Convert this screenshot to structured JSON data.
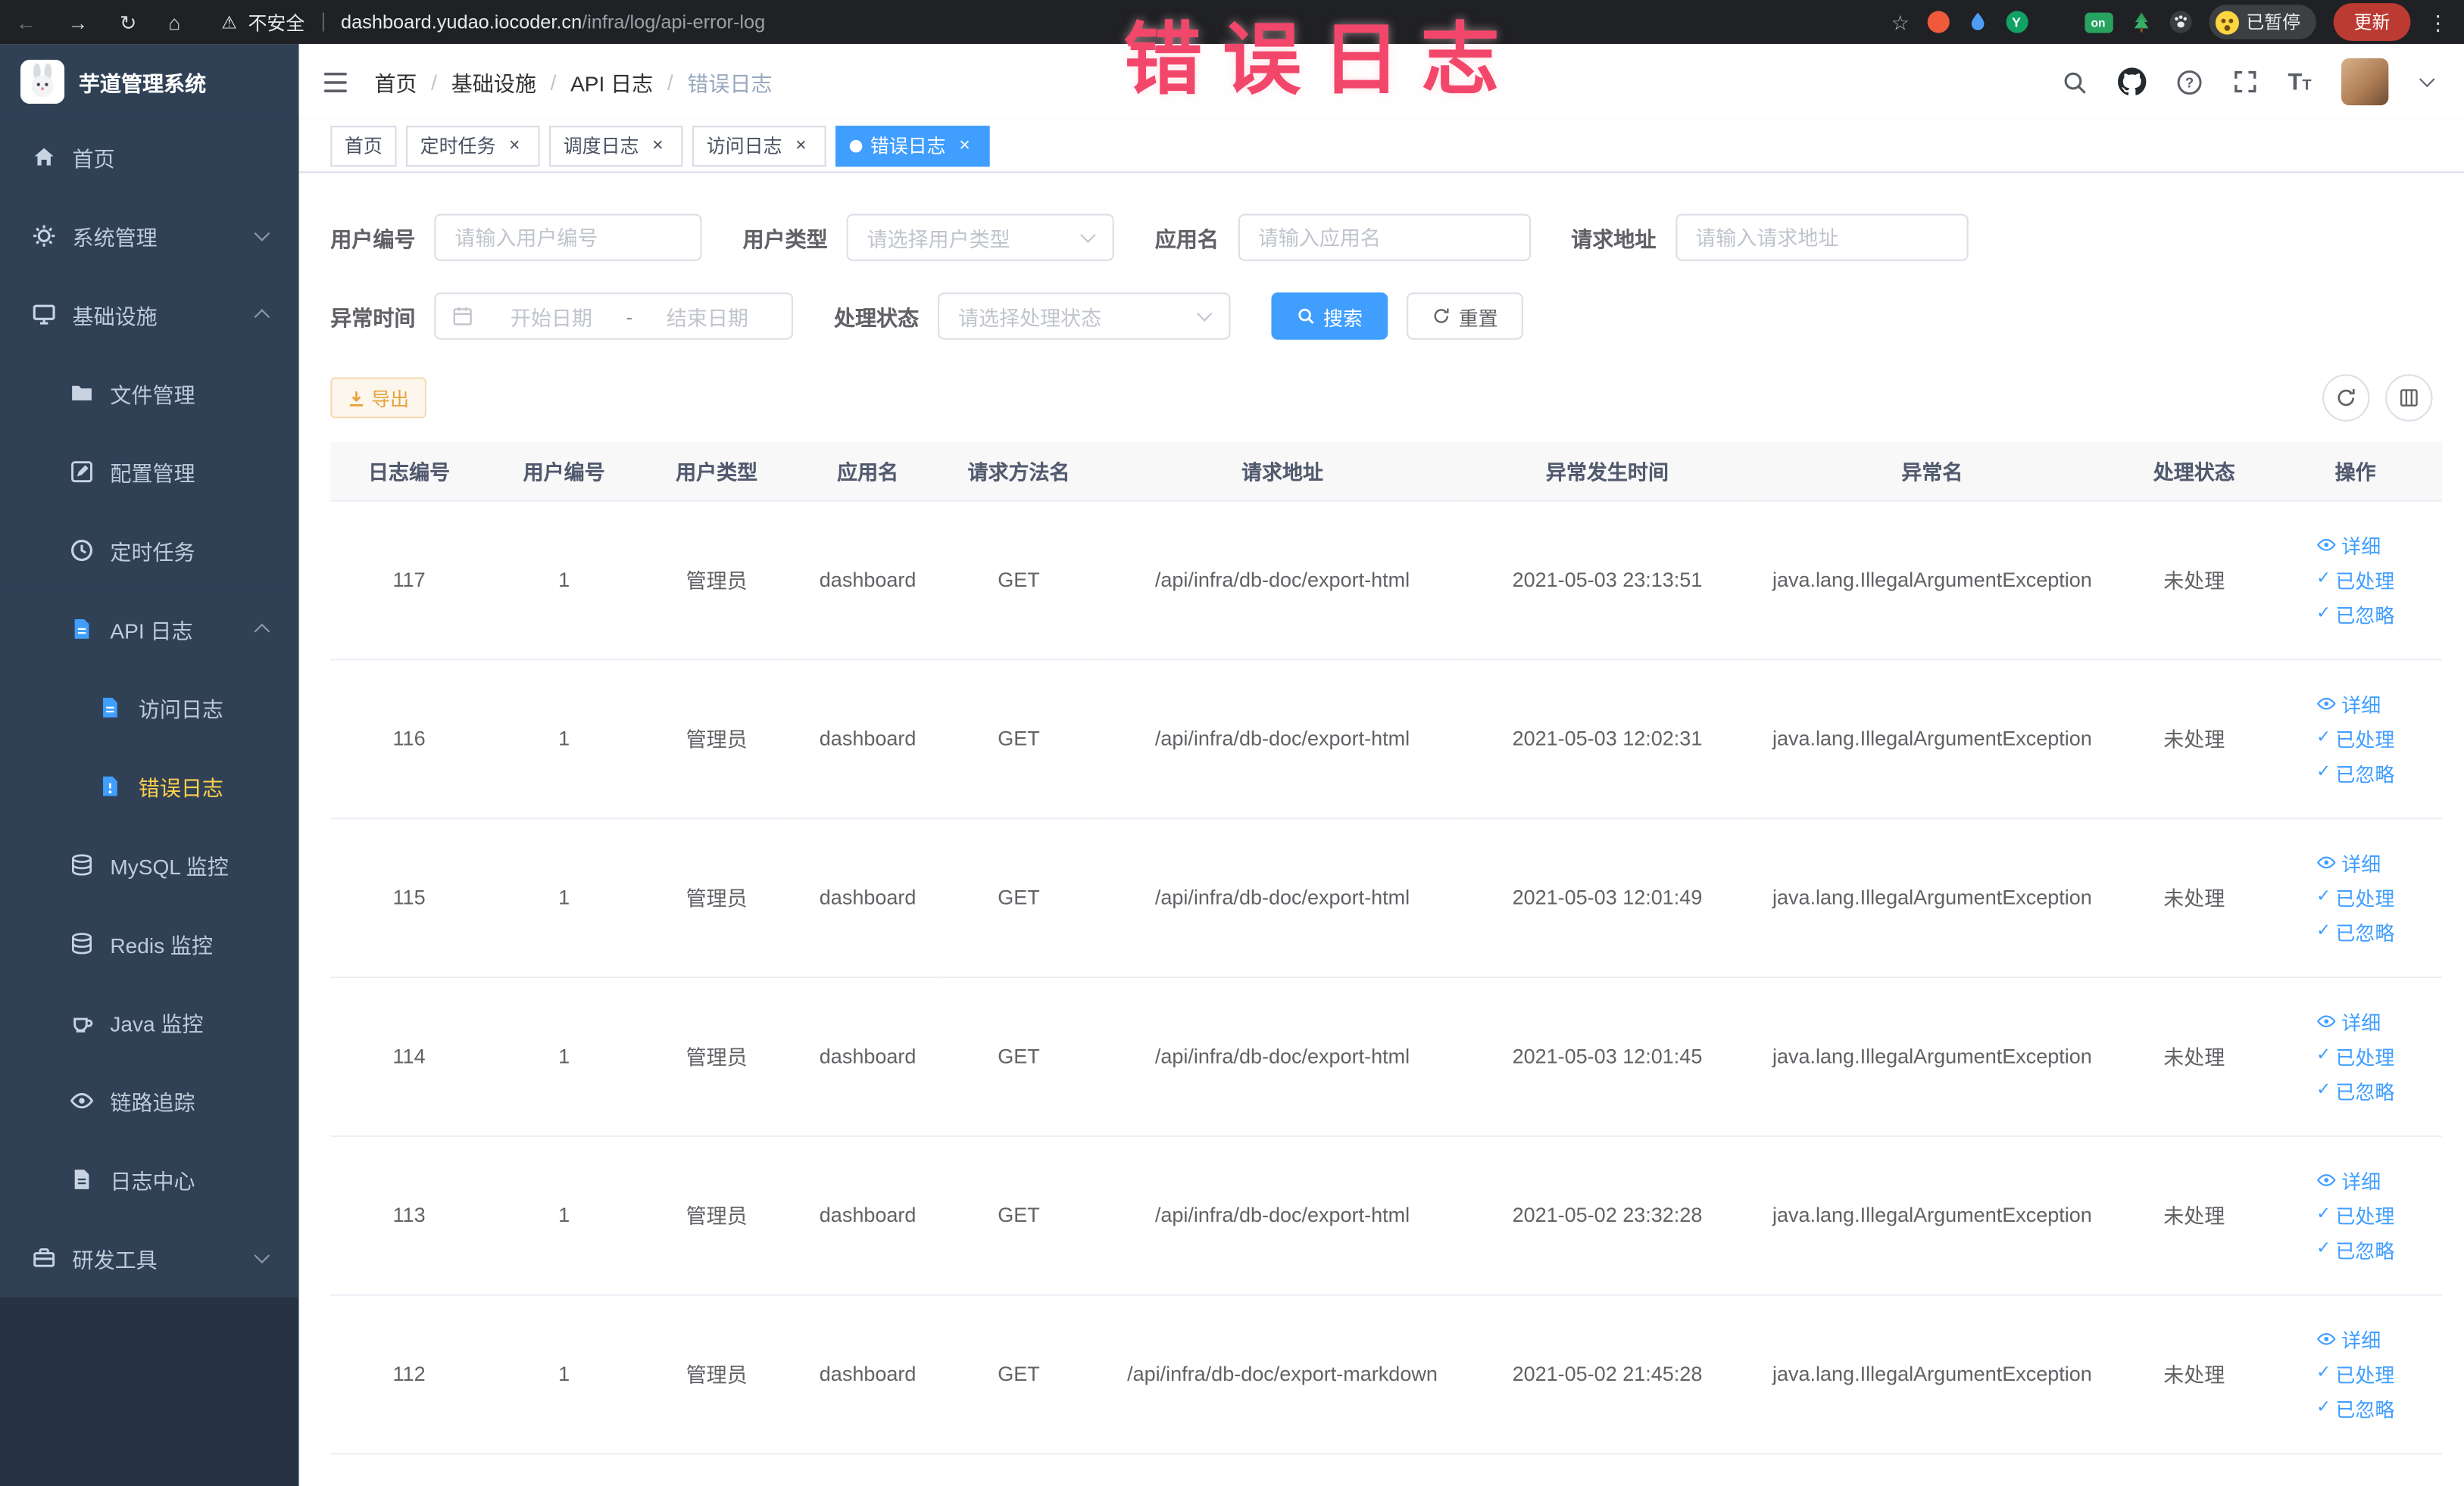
{
  "colors": {
    "primary": "#409eff",
    "warning": "#e6a23c",
    "sidebar_bg": "#304156",
    "sidebar_active_text": "#ffd04b",
    "annotation_red": "#f2476a"
  },
  "browser": {
    "security_label": "不安全",
    "url_domain": "dashboard.yudao.iocoder.cn",
    "url_path": "/infra/log/api-error-log",
    "on_badge": "on",
    "paused_badge": "已暂停",
    "update_button": "更新"
  },
  "annotation": "错误日志",
  "sidebar": {
    "logo_title": "芋道管理系统",
    "items": [
      {
        "key": "home",
        "label": "首页",
        "level": 1,
        "icon": "home"
      },
      {
        "key": "system-mgmt",
        "label": "系统管理",
        "level": 1,
        "icon": "system",
        "arrow": "down"
      },
      {
        "key": "infrastructure",
        "label": "基础设施",
        "level": 1,
        "icon": "infra",
        "arrow": "up"
      },
      {
        "key": "file-mgmt",
        "label": "文件管理",
        "level": 2,
        "icon": "file"
      },
      {
        "key": "config-mgmt",
        "label": "配置管理",
        "level": 2,
        "icon": "config"
      },
      {
        "key": "scheduled-jobs",
        "label": "定时任务",
        "level": 2,
        "icon": "job"
      },
      {
        "key": "api-log",
        "label": "API 日志",
        "level": 2,
        "icon": "api-log",
        "arrow": "up"
      },
      {
        "key": "access-log",
        "label": "访问日志",
        "level": 3,
        "icon": "access-log"
      },
      {
        "key": "error-log",
        "label": "错误日志",
        "level": 3,
        "icon": "error-log",
        "active": true
      },
      {
        "key": "mysql-monitor",
        "label": "MySQL 监控",
        "level": 2,
        "icon": "mysql"
      },
      {
        "key": "redis-monitor",
        "label": "Redis 监控",
        "level": 2,
        "icon": "redis"
      },
      {
        "key": "java-monitor",
        "label": "Java 监控",
        "level": 2,
        "icon": "java"
      },
      {
        "key": "link-trace",
        "label": "链路追踪",
        "level": 2,
        "icon": "trace"
      },
      {
        "key": "log-center",
        "label": "日志中心",
        "level": 2,
        "icon": "log-center"
      },
      {
        "key": "dev-tools",
        "label": "研发工具",
        "level": 1,
        "icon": "dev-tools",
        "arrow": "down"
      }
    ]
  },
  "header": {
    "breadcrumb": [
      "首页",
      "基础设施",
      "API 日志",
      "错误日志"
    ]
  },
  "tabs": [
    {
      "label": "首页",
      "closable": false,
      "active": false
    },
    {
      "label": "定时任务",
      "closable": true,
      "active": false
    },
    {
      "label": "调度日志",
      "closable": true,
      "active": false
    },
    {
      "label": "访问日志",
      "closable": true,
      "active": false
    },
    {
      "label": "错误日志",
      "closable": true,
      "active": true
    }
  ],
  "filters": {
    "user_id": {
      "label": "用户编号",
      "placeholder": "请输入用户编号",
      "value": ""
    },
    "user_type": {
      "label": "用户类型",
      "placeholder": "请选择用户类型",
      "value": ""
    },
    "app_name": {
      "label": "应用名",
      "placeholder": "请输入应用名",
      "value": ""
    },
    "request_url": {
      "label": "请求地址",
      "placeholder": "请输入请求地址",
      "value": ""
    },
    "exception_time": {
      "label": "异常时间",
      "start_placeholder": "开始日期",
      "separator": "-",
      "end_placeholder": "结束日期"
    },
    "process_status": {
      "label": "处理状态",
      "placeholder": "请选择处理状态",
      "value": ""
    },
    "search_button": "搜索",
    "reset_button": "重置"
  },
  "toolbar": {
    "export_button": "导出"
  },
  "table": {
    "columns": [
      "日志编号",
      "用户编号",
      "用户类型",
      "应用名",
      "请求方法名",
      "请求地址",
      "异常发生时间",
      "异常名",
      "处理状态",
      "操作"
    ],
    "action_labels": [
      "详细",
      "已处理",
      "已忽略"
    ],
    "rows": [
      {
        "log_id": "117",
        "user_id": "1",
        "user_type": "管理员",
        "app_name": "dashboard",
        "method": "GET",
        "url": "/api/infra/db-doc/export-html",
        "time": "2021-05-03 23:13:51",
        "exception": "java.lang.IllegalArgumentException",
        "status": "未处理"
      },
      {
        "log_id": "116",
        "user_id": "1",
        "user_type": "管理员",
        "app_name": "dashboard",
        "method": "GET",
        "url": "/api/infra/db-doc/export-html",
        "time": "2021-05-03 12:02:31",
        "exception": "java.lang.IllegalArgumentException",
        "status": "未处理"
      },
      {
        "log_id": "115",
        "user_id": "1",
        "user_type": "管理员",
        "app_name": "dashboard",
        "method": "GET",
        "url": "/api/infra/db-doc/export-html",
        "time": "2021-05-03 12:01:49",
        "exception": "java.lang.IllegalArgumentException",
        "status": "未处理"
      },
      {
        "log_id": "114",
        "user_id": "1",
        "user_type": "管理员",
        "app_name": "dashboard",
        "method": "GET",
        "url": "/api/infra/db-doc/export-html",
        "time": "2021-05-03 12:01:45",
        "exception": "java.lang.IllegalArgumentException",
        "status": "未处理"
      },
      {
        "log_id": "113",
        "user_id": "1",
        "user_type": "管理员",
        "app_name": "dashboard",
        "method": "GET",
        "url": "/api/infra/db-doc/export-html",
        "time": "2021-05-02 23:32:28",
        "exception": "java.lang.IllegalArgumentException",
        "status": "未处理"
      },
      {
        "log_id": "112",
        "user_id": "1",
        "user_type": "管理员",
        "app_name": "dashboard",
        "method": "GET",
        "url": "/api/infra/db-doc/export-markdown",
        "time": "2021-05-02 21:45:28",
        "exception": "java.lang.IllegalArgumentException",
        "status": "未处理"
      }
    ]
  }
}
